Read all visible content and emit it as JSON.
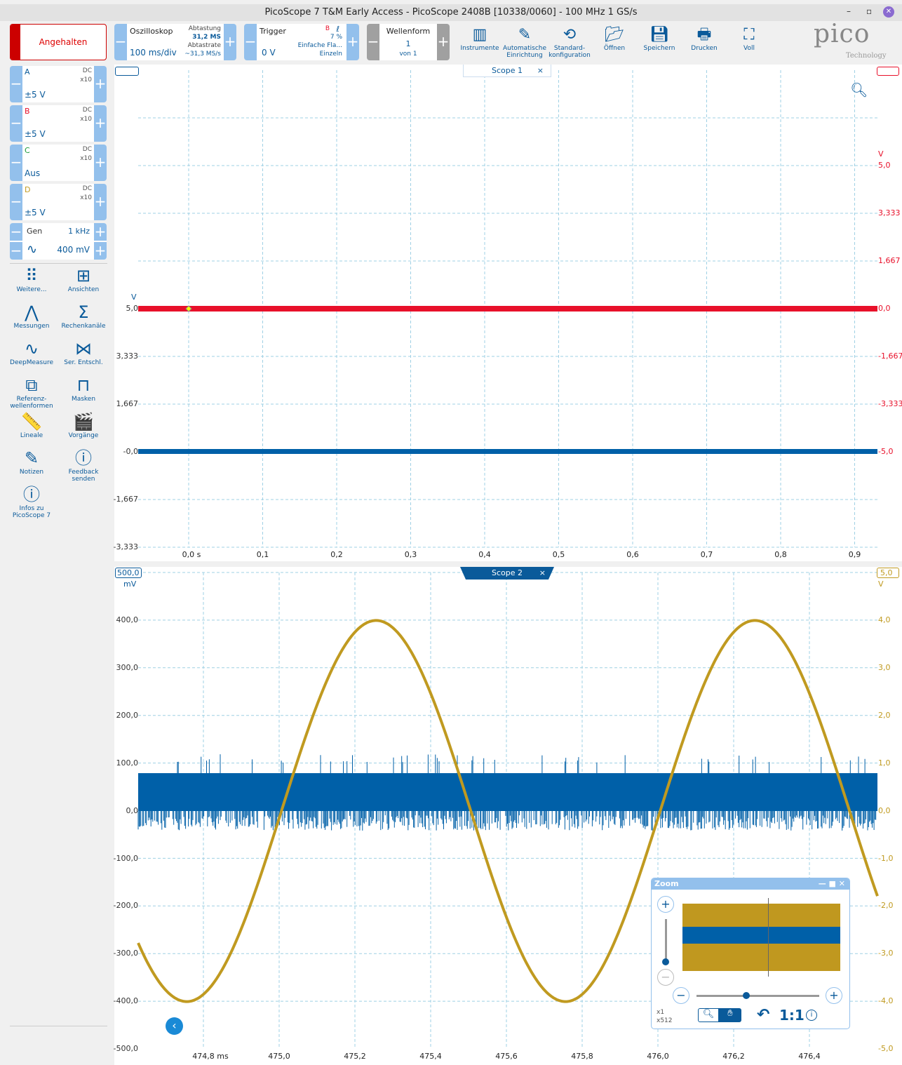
{
  "window": {
    "title": "PicoScope 7 T&M Early Access  - PicoScope 2408B [10338/0060] - 100 MHz 1 GS/s",
    "minimize": "–",
    "restore": "▫",
    "close": "✕"
  },
  "toolbar": {
    "run_state": "Angehalten",
    "scope": {
      "mode": "Oszilloskop",
      "timebase": "100 ms/div",
      "sampling_label": "Abtastung",
      "samples": "31,2 MS",
      "rate_label": "Abtastrate",
      "rate": "~31,3 MS/s"
    },
    "trigger": {
      "label": "Trigger",
      "channel": "B",
      "edge": "ℓ",
      "level_pct": "7 %",
      "type": "Einfache Fla...",
      "mode": "Einzeln",
      "level": "0 V"
    },
    "waveform": {
      "label": "Wellenform",
      "index": "1",
      "of": "von 1"
    },
    "tools": [
      {
        "icon": "instruments-icon",
        "label": "Instrumente"
      },
      {
        "icon": "auto-setup-icon",
        "label": "Automatische Einrichtung"
      },
      {
        "icon": "default-config-icon",
        "label": "Standard-konfiguration"
      },
      {
        "icon": "folder-open-icon",
        "label": "Öffnen"
      },
      {
        "icon": "save-icon",
        "label": "Speichern"
      },
      {
        "icon": "print-icon",
        "label": "Drucken"
      },
      {
        "icon": "fullscreen-icon",
        "label": "Voll"
      }
    ],
    "logo": "pico",
    "logo_sub": "Technology"
  },
  "channels": [
    {
      "name": "A",
      "coupling": "DC",
      "probe": "x10",
      "range": "±5 V",
      "color": "#0a5a9a"
    },
    {
      "name": "B",
      "coupling": "DC",
      "probe": "x10",
      "range": "±5 V",
      "color": "#e8102a"
    },
    {
      "name": "C",
      "coupling": "DC",
      "probe": "x10",
      "range": "Aus",
      "color": "#1a9a3a"
    },
    {
      "name": "D",
      "coupling": "DC",
      "probe": "x10",
      "range": "±5 V",
      "color": "#c09a20"
    }
  ],
  "generator": {
    "label": "Gen",
    "frequency": "1 kHz",
    "amplitude": "400 mV"
  },
  "side_tools": [
    {
      "icon": "more-icon",
      "glyph": "⠿",
      "label": "Weitere..."
    },
    {
      "icon": "views-icon",
      "glyph": "⊞",
      "label": "Ansichten"
    },
    {
      "icon": "measurements-icon",
      "glyph": "⋀",
      "label": "Messungen"
    },
    {
      "icon": "math-channels-icon",
      "glyph": "Σ",
      "label": "Rechenkanäle"
    },
    {
      "icon": "deepmeasure-icon",
      "glyph": "∿",
      "label": "DeepMeasure"
    },
    {
      "icon": "serial-decode-icon",
      "glyph": "⋈",
      "label": "Ser. Entschl."
    },
    {
      "icon": "reference-waveforms-icon",
      "glyph": "⧉",
      "label": "Referenz-wellenformen"
    },
    {
      "icon": "masks-icon",
      "glyph": "⊓",
      "label": "Masken"
    },
    {
      "icon": "rulers-icon",
      "glyph": "📏",
      "label": "Lineale"
    },
    {
      "icon": "actions-icon",
      "glyph": "🎬",
      "label": "Vorgänge"
    },
    {
      "icon": "notes-icon",
      "glyph": "✎",
      "label": "Notizen"
    },
    {
      "icon": "feedback-icon",
      "glyph": "ⓘ",
      "label": "Feedback senden"
    },
    {
      "icon": "about-icon",
      "glyph": "ⓘ",
      "label": "Infos zu PicoScope 7"
    }
  ],
  "scope1": {
    "tab": "Scope 1",
    "close": "×",
    "left_unit": "V",
    "right_unit": "V",
    "left_ticks": [
      "5,0",
      "3,333",
      "1,667",
      "-0,0",
      "-1,667",
      "-3,333"
    ],
    "right_ticks": [
      "5,0",
      "3,333",
      "1,667",
      "0,0",
      "-1,667",
      "-3,333",
      "-5,0"
    ],
    "x_ticks": [
      "0,0 s",
      "0,1",
      "0,2",
      "0,3",
      "0,4",
      "0,5",
      "0,6",
      "0,7",
      "0,8",
      "0,9"
    ],
    "trace_colors": {
      "A": "#0060a8",
      "B": "#e8102a"
    }
  },
  "scope2": {
    "tab": "Scope 2",
    "close": "×",
    "left_unit": "mV",
    "right_unit": "V",
    "left_marker": "500,0",
    "right_marker": "5,0",
    "left_ticks": [
      "400,0",
      "300,0",
      "200,0",
      "100,0",
      "0,0",
      "-100,0",
      "-200,0",
      "-300,0",
      "-400,0",
      "-500,0"
    ],
    "right_ticks": [
      "4,0",
      "3,0",
      "2,0",
      "1,0",
      "0,0",
      "-1,0",
      "-2,0",
      "-3,0",
      "-4,0",
      "-5,0"
    ],
    "x_ticks": [
      "474,8 ms",
      "475,0",
      "475,2",
      "475,4",
      "475,6",
      "475,8",
      "476,0",
      "476,2",
      "476,4"
    ],
    "sine": {
      "amplitude_mV": 400,
      "frequency_kHz": 1,
      "peak_ms": 475.256
    },
    "trace_colors": {
      "A": "#0060a8",
      "D": "#c09a20"
    }
  },
  "zoom_panel": {
    "title": "Zoom",
    "level_x": "x1",
    "level_y": "x512",
    "reset": "1:1",
    "h_slider": 0.45,
    "v_slider": 0.0
  }
}
